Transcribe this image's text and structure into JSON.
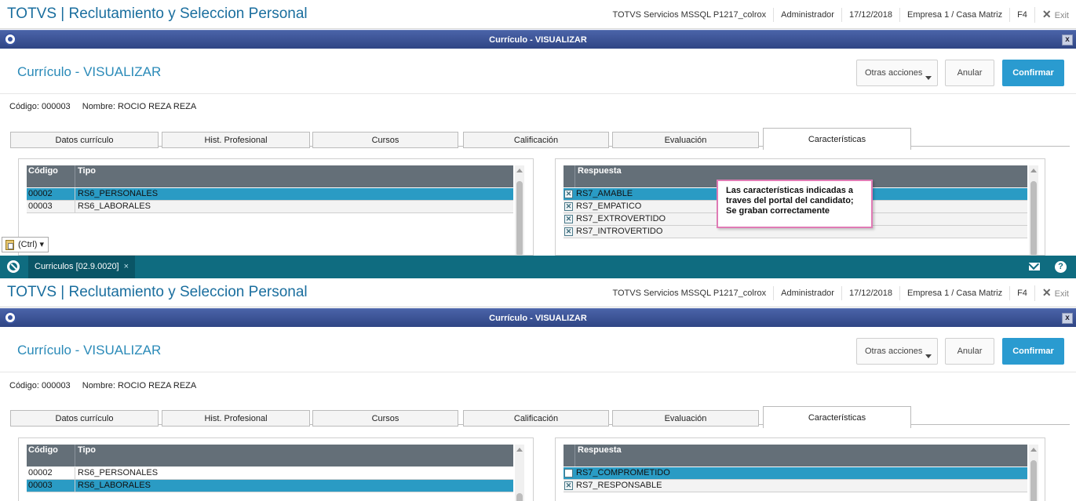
{
  "header": {
    "app_title": "TOTVS | Reclutamiento y Seleccion Personal",
    "server": "TOTVS Servicios MSSQL P1217_colrox",
    "user": "Administrador",
    "date": "17/12/2018",
    "company": "Empresa 1 / Casa Matriz",
    "shortcut": "F4",
    "exit_icon": "✕",
    "exit_label": "Exit"
  },
  "dialog": {
    "title": "Currículo - VISUALIZAR",
    "close_label": "x"
  },
  "form": {
    "title": "Currículo - VISUALIZAR",
    "actions_label": "Otras acciones",
    "cancel_label": "Anular",
    "confirm_label": "Confirmar",
    "code_text": "Código: 000003",
    "name_text": "Nombre: ROCIO REZA REZA"
  },
  "tabs": [
    "Datos currículo",
    "Hist. Profesional",
    "Cursos",
    "Calificación",
    "Evaluación",
    "Características"
  ],
  "grid": {
    "col_code": "Código",
    "col_type": "Tipo",
    "col_answer": "Respuesta"
  },
  "top_types": [
    {
      "code": "00002",
      "type": "RS6_PERSONALES"
    },
    {
      "code": "00003",
      "type": "RS6_LABORALES"
    }
  ],
  "top_answers": [
    {
      "label": "RS7_AMABLE",
      "checked": true
    },
    {
      "label": "RS7_EMPATICO",
      "checked": true
    },
    {
      "label": "RS7_EXTROVERTIDO",
      "checked": true
    },
    {
      "label": "RS7_INTROVERTIDO",
      "checked": true
    }
  ],
  "bottom_types": [
    {
      "code": "00002",
      "type": "RS6_PERSONALES"
    },
    {
      "code": "00003",
      "type": "RS6_LABORALES"
    }
  ],
  "bottom_answers": [
    {
      "label": "RS7_COMPROMETIDO",
      "checked": false
    },
    {
      "label": "RS7_RESPONSABLE",
      "checked": true
    }
  ],
  "tooltip": {
    "line1": "Las características indicadas a",
    "line2": "traves del portal del candidato;",
    "line3": "Se graban correctamente"
  },
  "paste_label": "(Ctrl) ▾",
  "taskbar": {
    "tab_label": "Curriculos [02.9.0020]",
    "tab_close": "×",
    "help_label": "?"
  },
  "colors": {
    "accent": "#2a9bd0",
    "selection": "#2a9bc4",
    "dialog_bar": "#34498a",
    "taskbar": "#0f6c80",
    "tooltip_border": "#e07bb5"
  }
}
